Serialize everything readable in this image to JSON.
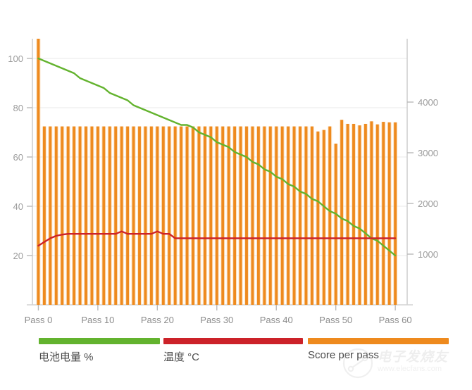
{
  "chart_data": {
    "type": "bar",
    "title": "",
    "subtitle": "",
    "xlabel": "",
    "ylabel": "",
    "grid": true,
    "legend_position": "bottom",
    "x_tick_labels": [
      "Pass 0",
      "Pass 10",
      "Pass 20",
      "Pass 30",
      "Pass 40",
      "Pass 50",
      "Pass 60"
    ],
    "x_tick_values": [
      0,
      10,
      20,
      30,
      40,
      50,
      60
    ],
    "xlim": [
      -1,
      62
    ],
    "left_axis": {
      "ticks": [
        20,
        40,
        60,
        80,
        100
      ],
      "tick_labels": [
        "20",
        "40",
        "60",
        "80",
        "100"
      ],
      "ylim": [
        0,
        108
      ]
    },
    "right_axis": {
      "ticks": [
        1000,
        2000,
        3000,
        4000
      ],
      "tick_labels": [
        "1000",
        "2000",
        "3000",
        "4000"
      ],
      "ylim": [
        0,
        5250
      ]
    },
    "x": [
      0,
      1,
      2,
      3,
      4,
      5,
      6,
      7,
      8,
      9,
      10,
      11,
      12,
      13,
      14,
      15,
      16,
      17,
      18,
      19,
      20,
      21,
      22,
      23,
      24,
      25,
      26,
      27,
      28,
      29,
      30,
      31,
      32,
      33,
      34,
      35,
      36,
      37,
      38,
      39,
      40,
      41,
      42,
      43,
      44,
      45,
      46,
      47,
      48,
      49,
      50,
      51,
      52,
      53,
      54,
      55,
      56,
      57,
      58,
      59,
      60
    ],
    "series": [
      {
        "name": "电池电量 %",
        "type": "line",
        "axis": "left",
        "color": "#63B32E",
        "unit": "%",
        "values": [
          100,
          99,
          98,
          97,
          96,
          95,
          94,
          92,
          91,
          90,
          89,
          88,
          86,
          85,
          84,
          83,
          81,
          80,
          79,
          78,
          77,
          76,
          75,
          74,
          73,
          73,
          72,
          70,
          69,
          68,
          66,
          65,
          64,
          62,
          61,
          60,
          58,
          57,
          55,
          54,
          52,
          51,
          49,
          48,
          46,
          45,
          43,
          42,
          40,
          38,
          37,
          35,
          34,
          32,
          31,
          29,
          27,
          26,
          24,
          22,
          20
        ]
      },
      {
        "name": "温度 °C",
        "type": "line",
        "axis": "left",
        "color": "#CC2229",
        "unit": "°C",
        "values": [
          24,
          25.5,
          27,
          28,
          28.5,
          28.8,
          28.8,
          28.8,
          28.8,
          28.8,
          28.8,
          28.8,
          28.8,
          28.8,
          29.8,
          28.8,
          28.8,
          28.8,
          28.8,
          28.8,
          29.8,
          28.8,
          28.8,
          27,
          27,
          27,
          27,
          27,
          27,
          27,
          27,
          27,
          27,
          27,
          27,
          27,
          27,
          27,
          27,
          27,
          27,
          27,
          27,
          27,
          27,
          27,
          27,
          27,
          27,
          27,
          27,
          27,
          27,
          27,
          27,
          27,
          27,
          27,
          27,
          27,
          27
        ]
      },
      {
        "name": "Score per pass",
        "type": "bar",
        "axis": "right",
        "color": "#EE8A1E",
        "values": [
          5250,
          3520,
          3520,
          3520,
          3520,
          3520,
          3520,
          3520,
          3520,
          3520,
          3520,
          3520,
          3520,
          3520,
          3520,
          3520,
          3520,
          3520,
          3520,
          3520,
          3520,
          3520,
          3520,
          3520,
          3520,
          3520,
          3520,
          3520,
          3520,
          3520,
          3520,
          3520,
          3520,
          3520,
          3520,
          3520,
          3520,
          3520,
          3520,
          3520,
          3520,
          3520,
          3520,
          3520,
          3520,
          3520,
          3520,
          3420,
          3450,
          3520,
          3180,
          3650,
          3570,
          3570,
          3540,
          3570,
          3620,
          3560,
          3610,
          3600,
          3600
        ]
      }
    ]
  },
  "legend": {
    "items": [
      {
        "label": "电池电量 %",
        "color": "#63B32E"
      },
      {
        "label": "温度 °C",
        "color": "#CC2229"
      },
      {
        "label": "Score per pass",
        "color": "#EE8A1E"
      }
    ]
  },
  "watermark": {
    "text": "电子发烧友",
    "url": "www.elecfans.com"
  }
}
